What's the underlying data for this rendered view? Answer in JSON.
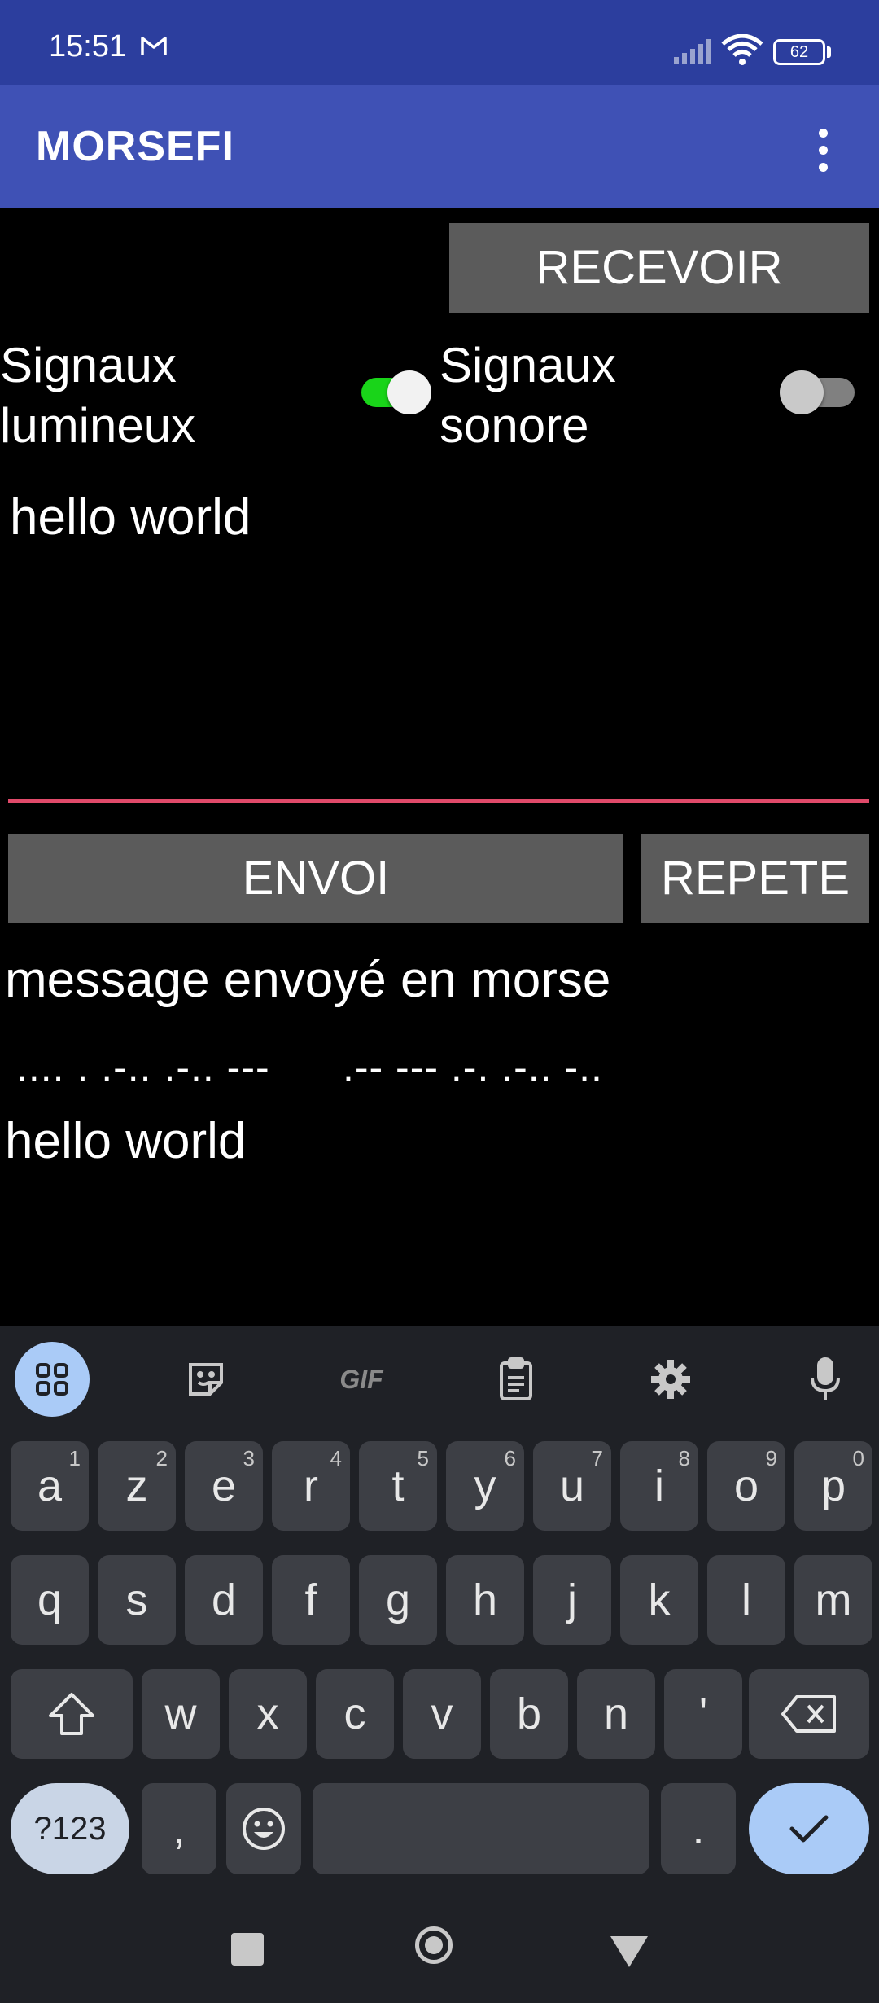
{
  "status_bar": {
    "time": "15:51",
    "battery": "62"
  },
  "app_bar": {
    "title": "MORSEFI"
  },
  "buttons": {
    "recevoir": "RECEVOIR",
    "envoi": "ENVOI",
    "repete": "REPETE"
  },
  "switches": {
    "light": {
      "label_line1": "Signaux",
      "label_line2": "lumineux",
      "on": true
    },
    "sound": {
      "label_line1": "Signaux",
      "label_line2": "sonore",
      "on": false
    }
  },
  "input": {
    "value": "hello world"
  },
  "output": {
    "title": "message envoyé en morse",
    "morse": ".... . .-.. .-.. ---      .-- --- .-. .-.. -..",
    "text": "hello world"
  },
  "keyboard": {
    "toolbar": [
      "apps-icon",
      "sticker-icon",
      "gif-icon",
      "clipboard-icon",
      "gear-icon",
      "microphone-icon"
    ],
    "gif_label": "GIF",
    "row1": [
      {
        "k": "a",
        "n": "1"
      },
      {
        "k": "z",
        "n": "2"
      },
      {
        "k": "e",
        "n": "3"
      },
      {
        "k": "r",
        "n": "4"
      },
      {
        "k": "t",
        "n": "5"
      },
      {
        "k": "y",
        "n": "6"
      },
      {
        "k": "u",
        "n": "7"
      },
      {
        "k": "i",
        "n": "8"
      },
      {
        "k": "o",
        "n": "9"
      },
      {
        "k": "p",
        "n": "0"
      }
    ],
    "row2": [
      "q",
      "s",
      "d",
      "f",
      "g",
      "h",
      "j",
      "k",
      "l",
      "m"
    ],
    "row3": [
      "w",
      "x",
      "c",
      "v",
      "b",
      "n",
      "'"
    ],
    "symbols": "?123",
    "comma": ",",
    "period": "."
  },
  "colors": {
    "status_bar": "#2c3e9e",
    "app_bar": "#3f51b5",
    "switch_on": "#19d419",
    "underline": "#e04a6a"
  }
}
